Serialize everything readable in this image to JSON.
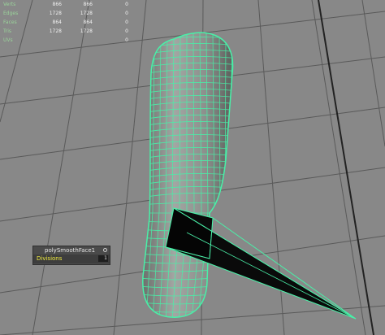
{
  "hud": {
    "rows": [
      {
        "label": "Verts",
        "c1": "866",
        "c2": "866",
        "c3": "0"
      },
      {
        "label": "Edges",
        "c1": "1728",
        "c2": "1728",
        "c3": "0"
      },
      {
        "label": "Faces",
        "c1": "864",
        "c2": "864",
        "c3": "0"
      },
      {
        "label": "Tris",
        "c1": "1728",
        "c2": "1728",
        "c3": "0"
      },
      {
        "label": "UVs",
        "c1": "",
        "c2": "",
        "c3": "0"
      }
    ]
  },
  "channel_box": {
    "node_name": "polySmoothFace1",
    "attribute_label": "Divisions",
    "attribute_value": "1"
  },
  "colors": {
    "viewport_bg": "#888888",
    "grid": "#5a5a5a",
    "grid_axis": "#222222",
    "mesh_wire": "#49f0a8",
    "mesh_fill": "#8a8d8a",
    "attribute_highlight": "#f0ec3f"
  }
}
